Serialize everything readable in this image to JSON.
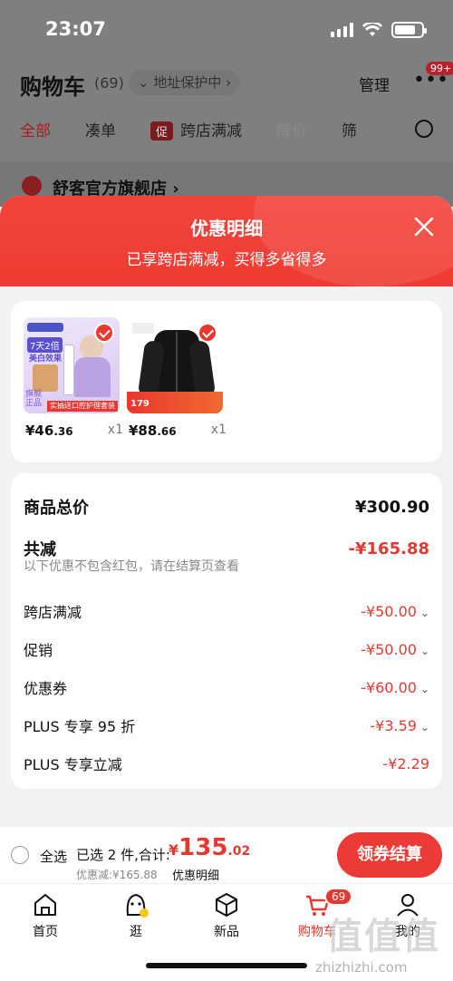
{
  "status": {
    "time": "23:07",
    "battery_level": 0.8
  },
  "background": {
    "title": "购物车",
    "count": "(69)",
    "address": "地址保护中",
    "manage": "管理",
    "more_badge": "99+",
    "tabs": [
      {
        "label": "全部",
        "state": "active"
      },
      {
        "label": "凑单",
        "state": "normal"
      },
      {
        "label": "跨店满减",
        "state": "normal",
        "tag": "促"
      },
      {
        "label": "降价",
        "state": "dim"
      },
      {
        "label": "筛",
        "state": "normal"
      }
    ],
    "store_name": "舒客官方旗舰店"
  },
  "sheet": {
    "title": "优惠明细",
    "subtitle": "已享跨店满减，买得多省得多",
    "products": [
      {
        "price_int": "¥46",
        "price_dec": ".36",
        "qty": "x1",
        "name": "美白护理套装",
        "img_labels": [
          "7天2倍",
          "美白效果",
          "旗舰正品",
          "实抽送口腔护理套装"
        ]
      },
      {
        "price_int": "¥88",
        "price_dec": ".66",
        "qty": "x1",
        "name": "黑色外套",
        "img_labels": [
          "179"
        ]
      }
    ],
    "rows": {
      "total_label": "商品总价",
      "total_value": "¥300.90",
      "reduce_label": "共减",
      "reduce_value": "-¥165.88",
      "note": "以下优惠不包含红包，请在结算页查看",
      "items": [
        {
          "label": "跨店满减",
          "value": "-¥50.00"
        },
        {
          "label": "促销",
          "value": "-¥50.00"
        },
        {
          "label": "优惠券",
          "value": "-¥60.00"
        },
        {
          "label": "PLUS 专享 95 折",
          "value": "-¥3.59"
        },
        {
          "label": "PLUS 专享立减",
          "value": "-¥2.29"
        }
      ]
    }
  },
  "bottom": {
    "select_all": "全选",
    "selected": "已选 2 件,合计:",
    "currency": "¥",
    "total_int": "135",
    "total_dec": ".02",
    "saved": "优惠减:¥165.88",
    "detail_link": "优惠明细",
    "checkout": "领券结算"
  },
  "tabbar": [
    {
      "label": "首页",
      "icon": "home-icon"
    },
    {
      "label": "逛",
      "icon": "explore-icon"
    },
    {
      "label": "新品",
      "icon": "box-icon"
    },
    {
      "label": "购物车",
      "icon": "cart-icon",
      "badge": "69",
      "active": true
    },
    {
      "label": "我的",
      "icon": "user-icon"
    }
  ],
  "watermark": {
    "text": "值值值",
    "url": "zhizhizhi.com"
  }
}
